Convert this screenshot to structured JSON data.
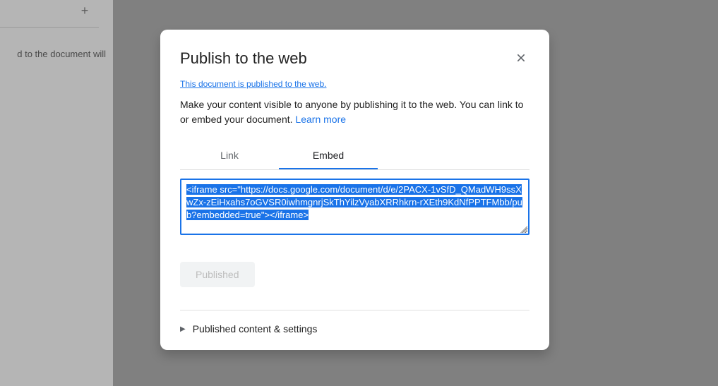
{
  "background": {
    "sidebar_text_fragment": "d to the document will"
  },
  "modal": {
    "title": "Publish to the web",
    "published_notice": "This document is published to the web.",
    "description_before": "Make your content visible to anyone by publishing it to the web. You can link to or embed your document. ",
    "learn_more": "Learn more",
    "tabs": {
      "link": "Link",
      "embed": "Embed"
    },
    "embed_code": "<iframe src=\"https://docs.google.com/document/d/e/2PACX-1vSfD_QMadWH9ssXwZx-zEiHxahs7oGVSR0iwhmgnrjSkThYilzVyabXRRhkrn-rXEth9KdNfPPTFMbb/pub?embedded=true\"></iframe>",
    "published_button": "Published",
    "collapsible_label": "Published content & settings"
  }
}
